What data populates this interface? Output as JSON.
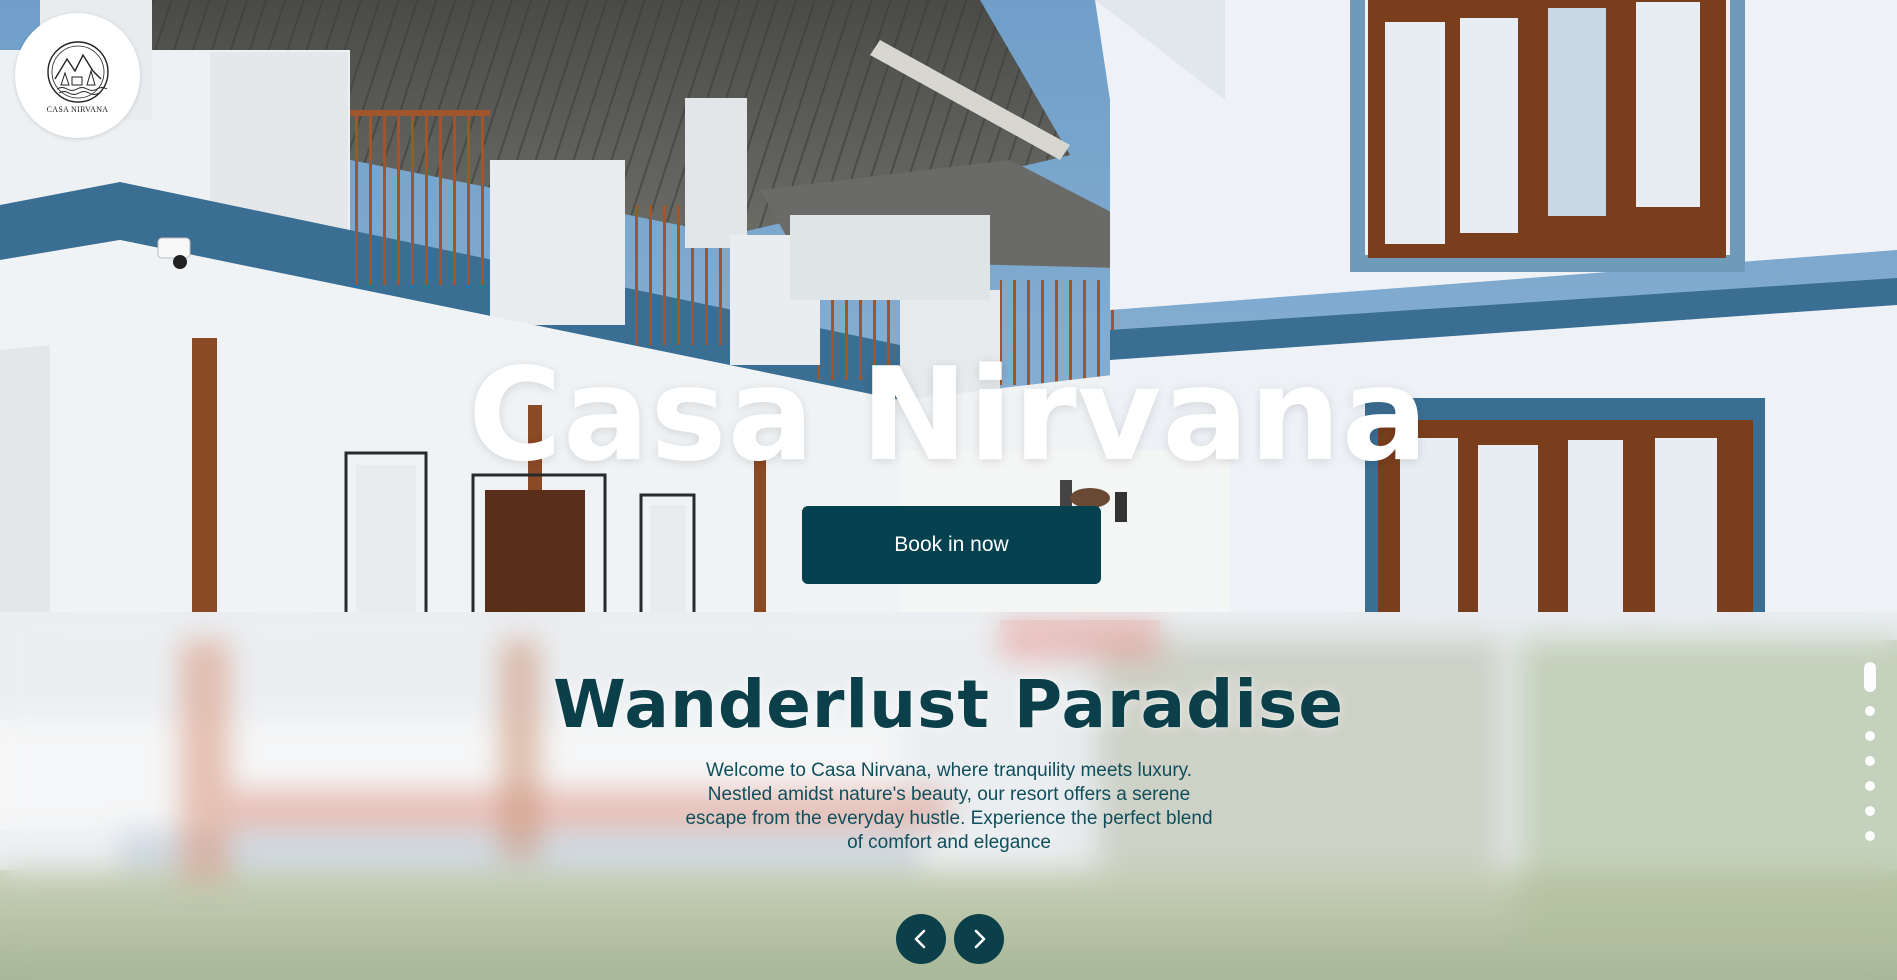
{
  "logo": {
    "text": "CASA NIRVANA"
  },
  "hero": {
    "title": "Casa Nirvana",
    "book_button": "Book in now"
  },
  "slide": {
    "title": "Wanderlust Paradise",
    "description_lines": [
      "Welcome to Casa Nirvana, where tranquility meets luxury.",
      "Nestled amidst nature's beauty, our resort offers a serene",
      "escape from the everyday hustle. Experience the perfect blend",
      "of comfort and elegance"
    ]
  },
  "carousel": {
    "slide_count": 7,
    "active_index": 0,
    "prev_icon": "chevron-left-icon",
    "next_icon": "chevron-right-icon"
  },
  "colors": {
    "primary": "#05414f",
    "heading_dark": "#0b3f4a",
    "sky": "#7fa9cc",
    "wall_white": "#eef2f6",
    "trim_blue": "#3b6e93",
    "wood": "#8a4a25"
  }
}
